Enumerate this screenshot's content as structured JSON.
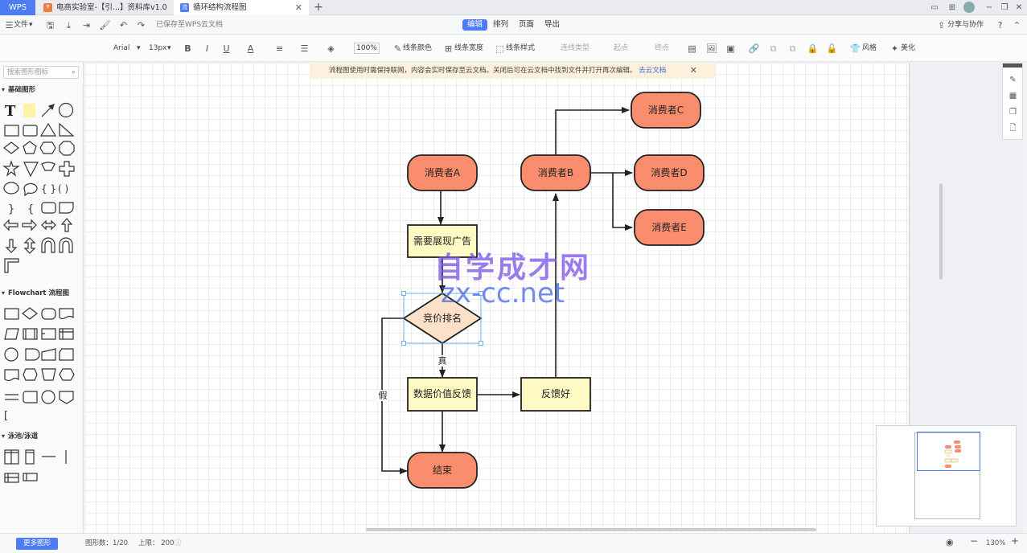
{
  "app": {
    "logo": "WPS"
  },
  "tabs": [
    {
      "label": "电商实验室-【引...】资料库v1.0",
      "icon": "P"
    },
    {
      "label": "循环结构流程图",
      "icon": "流"
    }
  ],
  "menubar": {
    "file": "文件",
    "saved_status": "已保存至WPS云文档",
    "tabs": [
      "编辑",
      "排列",
      "页面",
      "导出"
    ],
    "active_tab": "编辑",
    "share": "分享与协作"
  },
  "toolbar": {
    "font": "Arial",
    "font_size": "13px",
    "zoom": "100%",
    "line_color": "线条颜色",
    "line_width": "线条宽度",
    "line_style": "线条样式",
    "connector_type": "连线类型",
    "start": "起点",
    "end": "终点",
    "style": "风格",
    "beautify": "美化"
  },
  "leftpanel": {
    "search_placeholder": "搜索图形图标",
    "sections": [
      "基础图形",
      "Flowchart 流程图",
      "泳池/泳道"
    ],
    "more_shapes": "更多图形"
  },
  "notice": {
    "text": "流程图使用时需保持联网，内容会实时保存至云文档。关闭后可在云文档中找到文件并打开再次编辑。",
    "link": "去云文档"
  },
  "status": {
    "shape_count": "图形数：1/20",
    "limit": "上限： 200",
    "zoom": "130%"
  },
  "watermark": {
    "line1": "自学成才网",
    "line2": "zx-cc.net"
  },
  "colors": {
    "consumer": "#f98d6e",
    "process": "#fff9c4",
    "decision": "#fce0c8",
    "accent": "#4d7cf3"
  },
  "diagram": {
    "nodes": [
      {
        "id": "a",
        "label": "消费者A",
        "shape": "terminal"
      },
      {
        "id": "b",
        "label": "消费者B",
        "shape": "terminal"
      },
      {
        "id": "c",
        "label": "消费者C",
        "shape": "terminal"
      },
      {
        "id": "d",
        "label": "消费者D",
        "shape": "terminal"
      },
      {
        "id": "e",
        "label": "消费者E",
        "shape": "terminal"
      },
      {
        "id": "ad",
        "label": "需要展现广告",
        "shape": "process"
      },
      {
        "id": "bid",
        "label": "竞价排名",
        "shape": "decision"
      },
      {
        "id": "fb",
        "label": "数据价值反馈",
        "shape": "process"
      },
      {
        "id": "good",
        "label": "反馈好",
        "shape": "process"
      },
      {
        "id": "end",
        "label": "结束",
        "shape": "terminal"
      }
    ],
    "edges": [
      {
        "from": "a",
        "to": "ad"
      },
      {
        "from": "ad",
        "to": "bid"
      },
      {
        "from": "bid",
        "to": "fb",
        "label": "真"
      },
      {
        "from": "bid",
        "to": "end",
        "label": "假"
      },
      {
        "from": "fb",
        "to": "good"
      },
      {
        "from": "fb",
        "to": "end"
      },
      {
        "from": "good",
        "to": "b"
      },
      {
        "from": "b",
        "to": "c"
      },
      {
        "from": "b",
        "to": "d"
      },
      {
        "from": "b",
        "to": "e"
      }
    ]
  }
}
